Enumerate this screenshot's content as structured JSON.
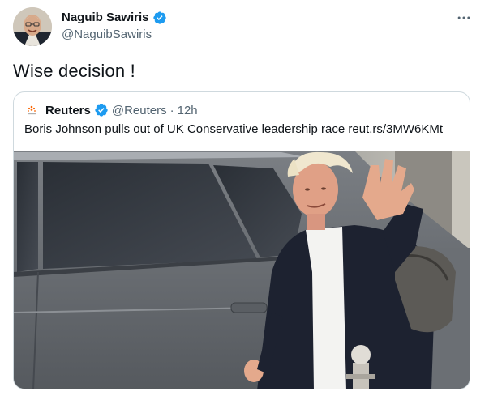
{
  "author": {
    "name": "Naguib Sawiris",
    "handle": "@NaguibSawiris"
  },
  "more_label": "•••",
  "tweet": {
    "text": "Wise decision !"
  },
  "quoted": {
    "name": "Reuters",
    "handle": "@Reuters",
    "separator": "·",
    "time": "12h",
    "text": "Boris Johnson pulls out of UK Conservative leadership race reut.rs/3MW6KMt"
  },
  "icons": {
    "verified": "verified-badge-icon",
    "more": "more-horizontal-icon",
    "reuters_logo": "reuters-logo-icon"
  },
  "colors": {
    "verified_blue": "#1d9bf0",
    "text_primary": "#0f1419",
    "text_secondary": "#536471",
    "border": "#cfd9de",
    "reuters_orange": "#fa6400"
  }
}
